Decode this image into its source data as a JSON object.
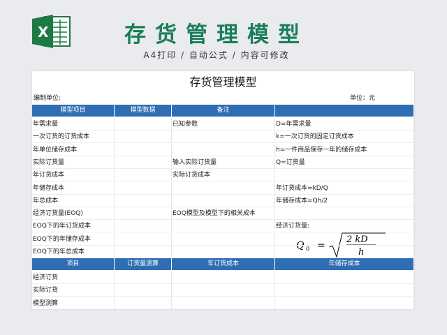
{
  "banner": {
    "app_icon": "excel-icon",
    "title": "存货管理模型",
    "subtitle": "A4打印 / 自动公式 / 内容可修改"
  },
  "sheet": {
    "title": "存货管理模型",
    "unit_label": "编制单位:",
    "currency_label": "单位：元",
    "header1": [
      "模型项目",
      "模型数据",
      "备注",
      ""
    ],
    "rows1": [
      [
        "年需求量",
        "",
        "已知参数",
        "D=年需求量"
      ],
      [
        "一次订货的订货成本",
        "",
        "",
        "k=一次订货的固定订货成本"
      ],
      [
        "年单位储存成本",
        "",
        "",
        "h=一件商品保存一年的储存成本"
      ],
      [
        "实际订货量",
        "",
        "输入实际订货量",
        "Q=订货量"
      ],
      [
        "年订货成本",
        "",
        "实际订货成本",
        ""
      ],
      [
        "年储存成本",
        "",
        "",
        "年订货成本=kD/Q"
      ],
      [
        "年总成本",
        "",
        "",
        "年储存成本=Qh/2"
      ],
      [
        "经济订货量(EOQ)",
        "",
        "EOQ模型及模型下的相关成本",
        ""
      ],
      [
        "EOQ下的年订货成本",
        "",
        "",
        "经济订货量:"
      ],
      [
        "EOQ下的年储存成本",
        "",
        "",
        ""
      ],
      [
        "EOQ下的年总成本",
        "",
        "",
        ""
      ]
    ],
    "formula": {
      "q": "Q",
      "sub": "0",
      "eq": "=",
      "num": "2 kD",
      "den": "h"
    },
    "header2": [
      "项目",
      "订货量测算",
      "年订货成本",
      "年储存成本"
    ],
    "rows2": [
      [
        "经济订货",
        "",
        "",
        ""
      ],
      [
        "实际订货",
        "",
        "",
        ""
      ],
      [
        "模型测算",
        "",
        "",
        ""
      ]
    ]
  },
  "colors": {
    "title_green": "#1a7e58",
    "header_blue": "#2f6eb4",
    "excel_green": "#1d7a45"
  }
}
